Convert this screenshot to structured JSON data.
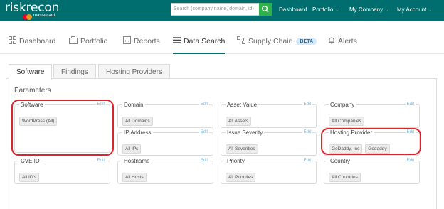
{
  "header": {
    "logo": "riskrecon",
    "logo_sub": "mastercard",
    "search_placeholder": "Search (company name, domain, id)",
    "nav": [
      "Dashboard",
      "Portfolio",
      "My Company",
      "My Account"
    ]
  },
  "mainnav": {
    "items": [
      "Dashboard",
      "Portfolio",
      "Reports",
      "Data Search",
      "Supply Chain",
      "Alerts"
    ],
    "beta": "BETA",
    "active": "Data Search"
  },
  "tabs": [
    "Software",
    "Findings",
    "Hosting Providers"
  ],
  "active_tab": "Software",
  "params_title": "Parameters",
  "edit_label": "Edit",
  "params": {
    "software": {
      "label": "Software",
      "chips": [
        "WordPress (All)"
      ]
    },
    "domain": {
      "label": "Domain",
      "chips": [
        "All Domains"
      ]
    },
    "asset_value": {
      "label": "Asset Value",
      "chips": [
        "All Assets"
      ]
    },
    "company": {
      "label": "Company",
      "chips": [
        "All Companies"
      ]
    },
    "ip_address": {
      "label": "IP Address",
      "chips": [
        "All IPs"
      ]
    },
    "issue_severity": {
      "label": "Issue Severity",
      "chips": [
        "All Severities"
      ]
    },
    "hosting_provider": {
      "label": "Hosting Provider",
      "chips": [
        "GoDaddy, Inc",
        "Godaddy"
      ]
    },
    "cve_id": {
      "label": "CVE ID",
      "chips": [
        "All ID's"
      ]
    },
    "hostname": {
      "label": "Hostname",
      "chips": [
        "All Hosts"
      ]
    },
    "priority": {
      "label": "Priority",
      "chips": [
        "All Priorities"
      ]
    },
    "country": {
      "label": "Country",
      "chips": [
        "All Countries"
      ]
    }
  },
  "colors": {
    "header": "#006e6e",
    "search_button": "#2db34a",
    "highlight": "#d8262c",
    "edit": "#7fb3d5"
  }
}
